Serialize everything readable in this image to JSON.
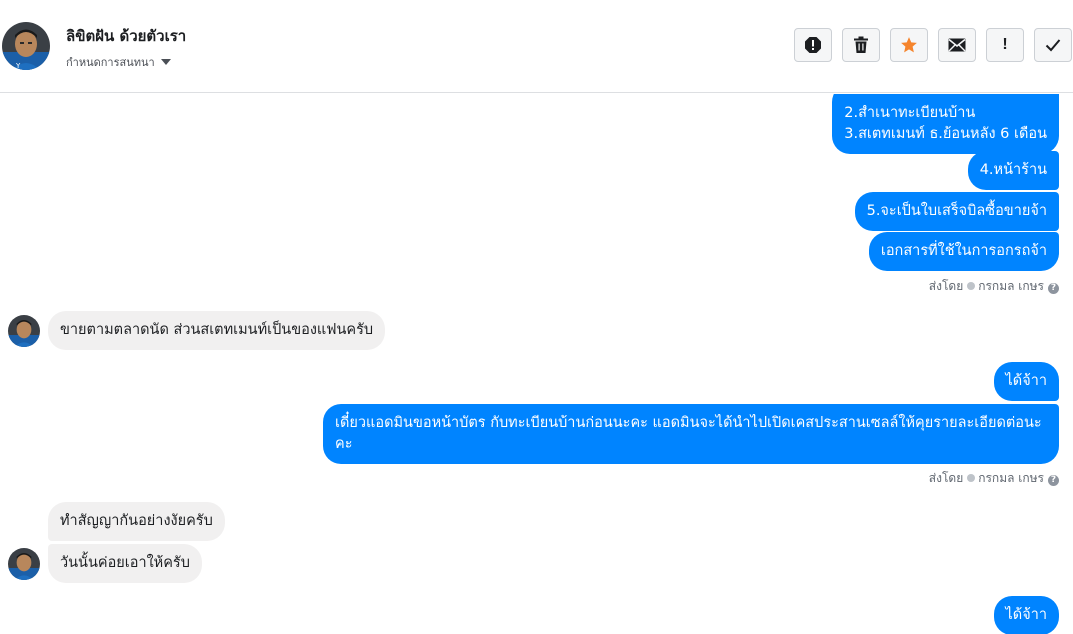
{
  "header": {
    "contact_name": "ลิขิตฝัน ด้วยตัวเรา",
    "settings_label": "กำหนดการสนทนา",
    "actions": {
      "report": "!",
      "delete": "trash",
      "star": "star",
      "mark_unread": "envelope",
      "important": "!",
      "done": "check"
    }
  },
  "messages": {
    "m1_line1": "2.สำเนาทะเบียนบ้าน",
    "m1_line2": "3.สเตทเมนท์ ธ.ย้อนหลัง 6 เดือน",
    "m2": "4.หน้าร้าน",
    "m3": "5.จะเป็นใบเสร็จบิลซื้อขายจ้า",
    "m4": "เอกสารที่ใช้ในการอกรถจ้า",
    "sent_by_1": {
      "prefix": "ส่งโดย",
      "name": "กรกมล เกษร"
    },
    "m5": "ขายตามตลาดนัด ส่วนสเตทเมนท์เป็นของแฟนครับ",
    "m6": "ได้จ้าา",
    "m7": "เดี๋ยวแอดมินขอหน้าบัตร กับทะเบียนบ้านก่อนนะคะ แอดมินจะได้นำไปเปิดเคสประสานเซลล์ให้คุยรายละเอียดต่อนะคะ",
    "sent_by_2": {
      "prefix": "ส่งโดย",
      "name": "กรกมล เกษร"
    },
    "m8": "ทำสัญญากันอย่างงัยครับ",
    "m9": "วันนั้นค่อยเอาให้ครับ",
    "m10": "ได้จ้าา"
  },
  "colors": {
    "outgoing_bubble": "#0084ff",
    "incoming_bubble": "#f1f0f0",
    "star": "#f5842c"
  }
}
